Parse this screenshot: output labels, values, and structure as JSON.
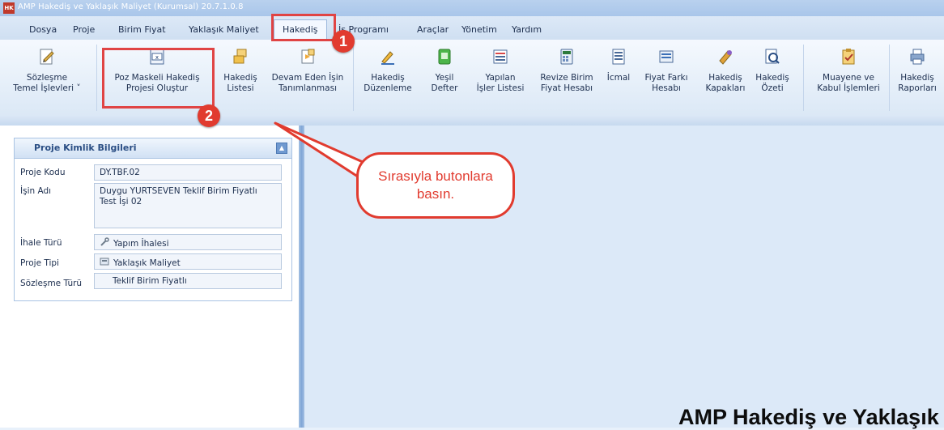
{
  "window": {
    "title": "AMP Hakediş ve Yaklaşık Maliyet (Kurumsal) 20.7.1.0.8",
    "app_icon_text": "HK"
  },
  "menu": {
    "items": [
      "Dosya",
      "Proje",
      "Birim Fiyat",
      "Yaklaşık Maliyet",
      "Hakediş",
      "İş Programı",
      "Araçlar",
      "Yönetim",
      "Yardım"
    ],
    "active": "Hakediş",
    "partial_visible": "İş Programı"
  },
  "ribbon": {
    "buttons": [
      {
        "l1": "Sözleşme",
        "l2": "Temel İşlevleri ˅",
        "icon": "contract-edit-icon"
      },
      {
        "l1": "Poz Maskeli Hakediş",
        "l2": "Projesi Oluştur",
        "icon": "masked-project-icon"
      },
      {
        "l1": "Hakediş",
        "l2": "Listesi",
        "icon": "folder-list-icon"
      },
      {
        "l1": "Devam Eden İşin",
        "l2": "Tanımlanması",
        "icon": "ongoing-work-icon"
      },
      {
        "l1": "Hakediş",
        "l2": "Düzenleme",
        "icon": "edit-icon"
      },
      {
        "l1": "Yeşil",
        "l2": "Defter",
        "icon": "green-book-icon"
      },
      {
        "l1": "Yapılan",
        "l2": "İşler Listesi",
        "icon": "work-list-icon"
      },
      {
        "l1": "Revize Birim",
        "l2": "Fiyat Hesabı",
        "icon": "calculator-icon"
      },
      {
        "l1": "İcmal",
        "l2": "",
        "icon": "summary-icon"
      },
      {
        "l1": "Fiyat Farkı",
        "l2": "Hesabı",
        "icon": "price-diff-icon"
      },
      {
        "l1": "Hakediş",
        "l2": "Kapakları",
        "icon": "cover-icon"
      },
      {
        "l1": "Hakediş",
        "l2": "Özeti",
        "icon": "magnifier-icon"
      },
      {
        "l1": "Muayene ve",
        "l2": "Kabul İşlemleri",
        "icon": "inspection-icon"
      },
      {
        "l1": "Hakediş",
        "l2": "Raporları",
        "icon": "printer-icon"
      }
    ]
  },
  "panel": {
    "title": "Proje Kimlik Bilgileri",
    "rows": [
      {
        "label": "Proje Kodu",
        "value": "DY.TBF.02"
      },
      {
        "label": "İşin Adı",
        "value": "Duygu YURTSEVEN Teklif Birim Fiyatlı Test İşi 02"
      },
      {
        "label": "İhale Türü",
        "value": "Yapım İhalesi",
        "icon": "tools-icon"
      },
      {
        "label": "Proje Tipi",
        "value": "Yaklaşık Maliyet",
        "icon": "calculator-icon"
      },
      {
        "label": "Sözleşme Türü",
        "value": "Teklif Birim Fiyatlı"
      }
    ]
  },
  "annotations": {
    "badge1": "1",
    "badge2": "2",
    "callout": "Sırasıyla butonlara basın."
  },
  "bottom_text": "AMP Hakediş ve Yaklaşık",
  "colors": {
    "accent_red": "#e13b2f",
    "menu_bg": "#dde9f7",
    "panel_title": "#2a4e84"
  }
}
